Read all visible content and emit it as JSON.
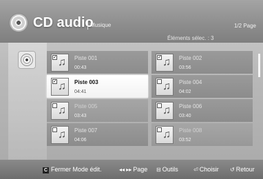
{
  "header": {
    "title": "CD audio",
    "subtitle": "Musique",
    "page_indicator": "1/2 Page",
    "selected_count": "Éléments sélec. : 3",
    "icon": "disc-icon"
  },
  "sidebar": {
    "icon": "disc-icon"
  },
  "tracks": [
    {
      "name": "Piste 001",
      "time": "00:43",
      "checked": true,
      "state": "normal"
    },
    {
      "name": "Piste 002",
      "time": "03:56",
      "checked": true,
      "state": "normal"
    },
    {
      "name": "Piste 003",
      "time": "04:41",
      "checked": true,
      "state": "active"
    },
    {
      "name": "Piste 004",
      "time": "04:02",
      "checked": false,
      "state": "normal"
    },
    {
      "name": "Piste 005",
      "time": "03:43",
      "checked": false,
      "state": "dim"
    },
    {
      "name": "Piste 006",
      "time": "03:40",
      "checked": false,
      "state": "normal"
    },
    {
      "name": "Piste 007",
      "time": "04:06",
      "checked": false,
      "state": "normal"
    },
    {
      "name": "Piste 008",
      "time": "03:52",
      "checked": false,
      "state": "dim"
    }
  ],
  "footer": {
    "close_edit_label": "Fermer Mode édit.",
    "close_edit_key": "C",
    "page_label": "Page",
    "page_icon": "◂◂ ▸▸",
    "tools_label": "Outils",
    "tools_icon": "tools-icon",
    "choose_label": "Choisir",
    "choose_icon": "enter-icon",
    "return_label": "Retour",
    "return_icon": "return-icon"
  }
}
